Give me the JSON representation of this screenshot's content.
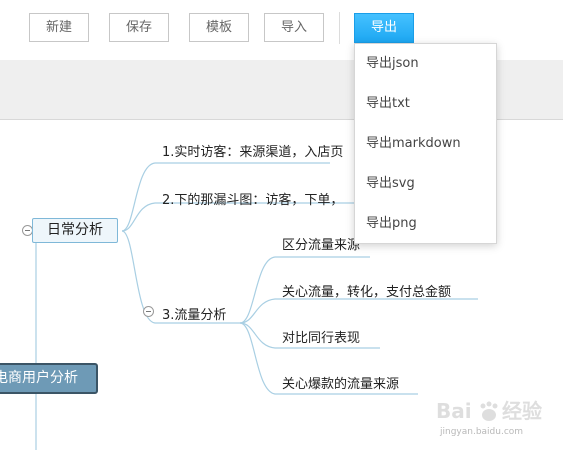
{
  "toolbar": {
    "new_label": "新建",
    "save_label": "保存",
    "template_label": "模板",
    "import_label": "导入",
    "export_label": "导出"
  },
  "export_menu": {
    "items": [
      "导出json",
      "导出txt",
      "导出markdown",
      "导出svg",
      "导出png"
    ]
  },
  "mindmap": {
    "root": "电商用户分析",
    "daily": "日常分析",
    "branch1": "1.实时访客：来源渠道，入店页",
    "branch2": "2.下的那漏斗图：访客，下单，",
    "branch3": "3.流量分析",
    "sub1": "区分流量来源",
    "sub2": "关心流量，转化，支付总金额",
    "sub3": "对比同行表现",
    "sub4": "关心爆款的流量来源"
  },
  "watermark": {
    "logo_text": "Bai du 经验",
    "url": "jingyan.baidu.com"
  },
  "colors": {
    "export_button": "#1da7f2",
    "root_node": "#6e9ab6",
    "branch_line": "#a9cfe3"
  }
}
